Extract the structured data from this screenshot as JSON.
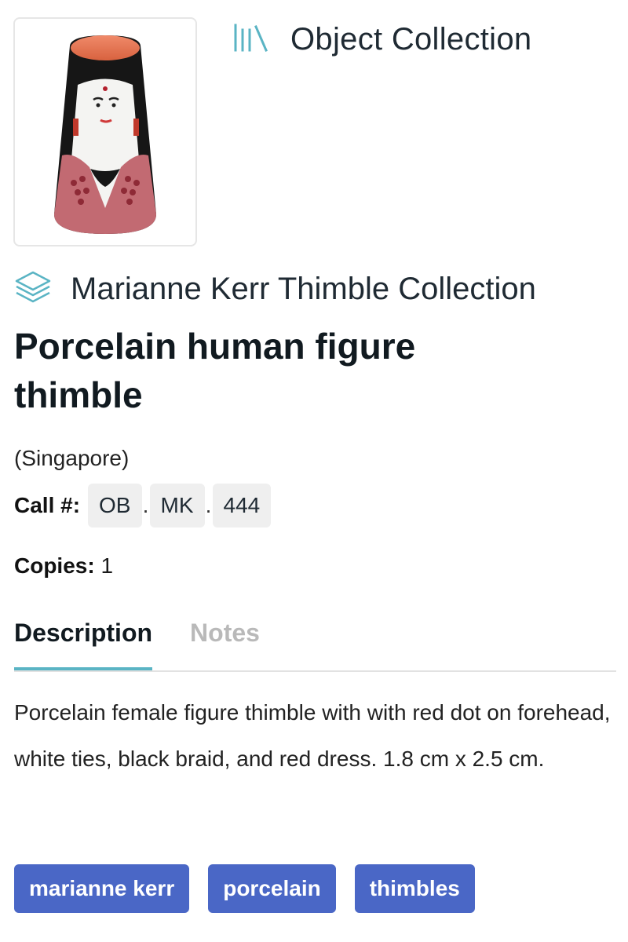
{
  "header": {
    "collection_type": "Object Collection",
    "collection_type_icon": "library-books-icon",
    "accent_color": "#5ab4c4"
  },
  "item": {
    "image_alt": "Porcelain thimble shaped as a female figure",
    "subcollection": "Marianne Kerr Thimble Collection",
    "subcollection_icon": "layers-icon",
    "title": "Porcelain human figure thimble",
    "origin": "(Singapore)",
    "call_number_label": "Call #:",
    "call_number_parts": [
      "OB",
      "MK",
      "444"
    ],
    "call_number_separator": ".",
    "copies_label": "Copies:",
    "copies_value": "1"
  },
  "tabs": {
    "description": "Description",
    "notes": "Notes",
    "active": "Description"
  },
  "description": "Porcelain female figure thimble with with red dot on forehead, white ties, black braid, and red dress. 1.8 cm x 2.5 cm.",
  "tags": [
    "marianne kerr",
    "porcelain",
    "thimbles"
  ],
  "tag_color": "#4a67c6"
}
